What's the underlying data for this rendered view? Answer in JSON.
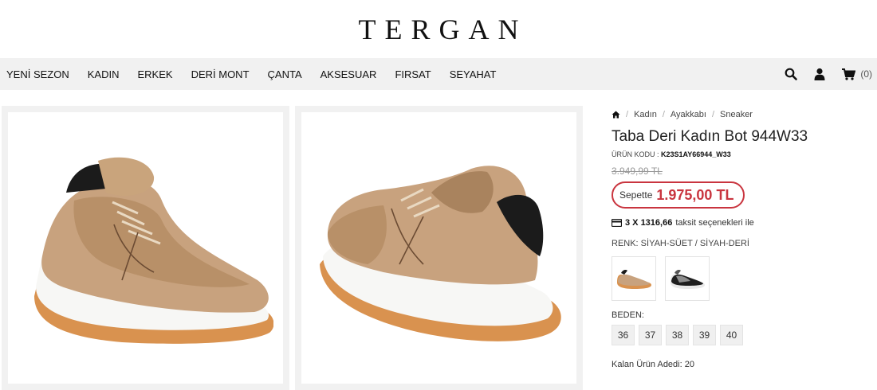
{
  "brand": {
    "logo": "TERGAN"
  },
  "nav": {
    "items": [
      "YENİ SEZON",
      "KADIN",
      "ERKEK",
      "DERİ MONT",
      "ÇANTA",
      "AKSESUAR",
      "FIRSAT",
      "SEYAHAT"
    ],
    "cart_count": "(0)",
    "icons": [
      "search-icon",
      "user-icon",
      "cart-icon"
    ]
  },
  "breadcrumb": [
    "Kadın",
    "Ayakkabı",
    "Sneaker"
  ],
  "product": {
    "title": "Taba Deri Kadın Bot 944W33",
    "code_label": "ÜRÜN KODU :",
    "code": "K23S1AY66944_W33",
    "old_price": "3.949,99 TL",
    "price_label": "Sepette",
    "price": "1.975,00 TL",
    "installment_bold": "3 X 1316,66",
    "installment_text": "taksit seçenekleri ile",
    "color_label": "RENK: SİYAH-SÜET / SİYAH-DERİ",
    "size_label": "BEDEN:",
    "sizes": [
      "36",
      "37",
      "38",
      "39",
      "40"
    ],
    "stock": "Kalan Ürün Adedi: 20"
  },
  "colors": {
    "accent": "#c9353f",
    "nav_bg": "#f1f1f1"
  }
}
